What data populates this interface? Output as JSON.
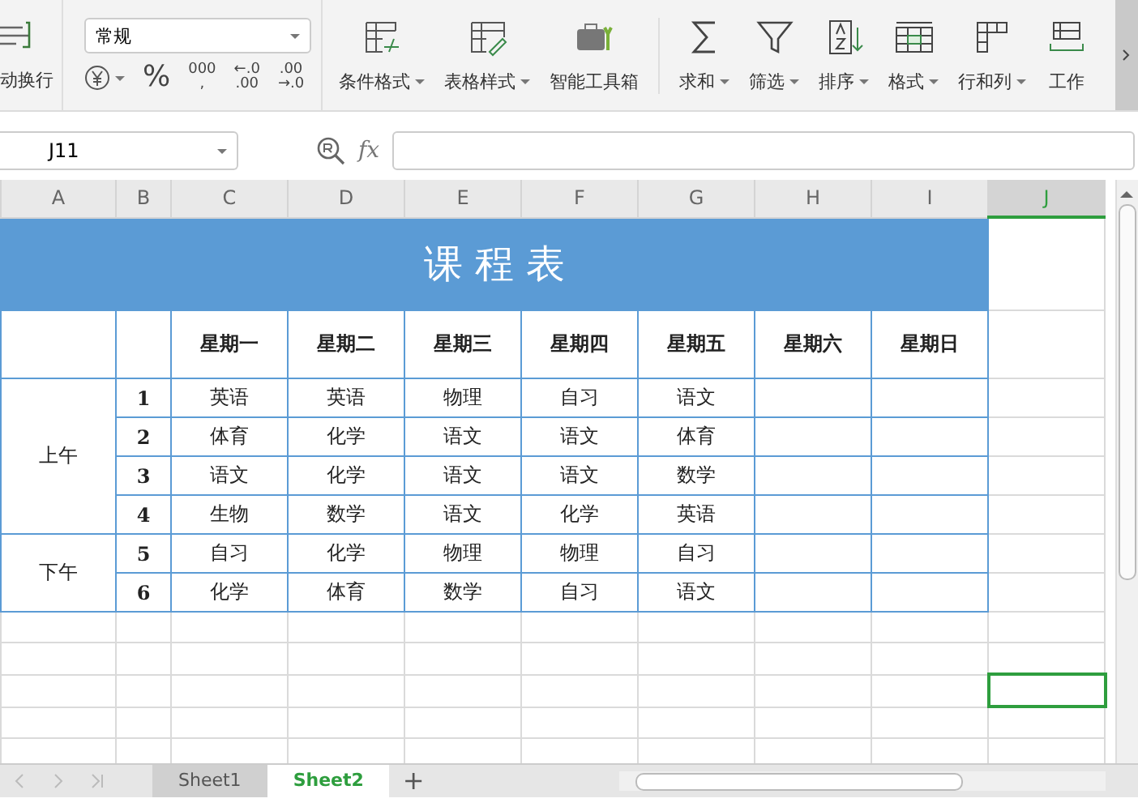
{
  "toolbar": {
    "wrap_label": "动换行",
    "number_format": "常规",
    "number_buttons": [
      {
        "kind": "currency",
        "dropdown": true
      },
      {
        "kind": "text",
        "lines": [
          "%"
        ]
      },
      {
        "kind": "text",
        "lines": [
          "000",
          ","
        ]
      },
      {
        "kind": "text",
        "lines": [
          "←.0",
          ".00"
        ]
      },
      {
        "kind": "text",
        "lines": [
          ".00",
          "→.0"
        ]
      }
    ],
    "tools": [
      {
        "label": "条件格式",
        "dropdown": true
      },
      {
        "label": "表格样式",
        "dropdown": true
      },
      {
        "label": "智能工具箱",
        "dropdown": false
      },
      {
        "label": "求和",
        "dropdown": true
      },
      {
        "label": "筛选",
        "dropdown": true
      },
      {
        "label": "排序",
        "dropdown": true
      },
      {
        "label": "格式",
        "dropdown": true
      },
      {
        "label": "行和列",
        "dropdown": true
      },
      {
        "label": "工作",
        "dropdown": false
      }
    ]
  },
  "formula_bar": {
    "cell_ref": "J11",
    "fx": "fx"
  },
  "columns": [
    {
      "label": "A",
      "selected": false
    },
    {
      "label": "B",
      "selected": false
    },
    {
      "label": "C",
      "selected": false
    },
    {
      "label": "D",
      "selected": false
    },
    {
      "label": "E",
      "selected": false
    },
    {
      "label": "F",
      "selected": false
    },
    {
      "label": "G",
      "selected": false
    },
    {
      "label": "H",
      "selected": false
    },
    {
      "label": "I",
      "selected": false
    },
    {
      "label": "J",
      "selected": true
    }
  ],
  "timetable": {
    "title": "课 程 表",
    "days": [
      "星期一",
      "星期二",
      "星期三",
      "星期四",
      "星期五",
      "星期六",
      "星期日"
    ],
    "periods": [
      {
        "label": "上午",
        "rows": [
          {
            "num": "1",
            "subjects": [
              "英语",
              "英语",
              "物理",
              "自习",
              "语文"
            ]
          },
          {
            "num": "2",
            "subjects": [
              "体育",
              "化学",
              "语文",
              "语文",
              "体育"
            ]
          },
          {
            "num": "3",
            "subjects": [
              "语文",
              "化学",
              "语文",
              "语文",
              "数学"
            ]
          },
          {
            "num": "4",
            "subjects": [
              "生物",
              "数学",
              "语文",
              "化学",
              "英语"
            ]
          }
        ]
      },
      {
        "label": "下午",
        "rows": [
          {
            "num": "5",
            "subjects": [
              "自习",
              "化学",
              "物理",
              "物理",
              "自习"
            ]
          },
          {
            "num": "6",
            "subjects": [
              "化学",
              "体育",
              "数学",
              "自习",
              "语文"
            ]
          }
        ]
      }
    ]
  },
  "empty_rows": [
    {
      "selected": false
    },
    {
      "selected": false
    },
    {
      "selected": true
    },
    {
      "selected": false
    },
    {
      "selected": false
    }
  ],
  "sheet_tabs": [
    {
      "label": "Sheet1",
      "selected": false
    },
    {
      "label": "Sheet2",
      "selected": true
    }
  ],
  "add_sheet": "+"
}
